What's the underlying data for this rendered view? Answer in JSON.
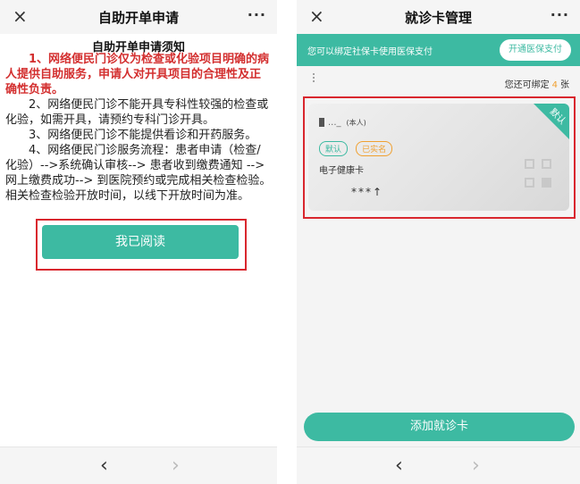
{
  "left": {
    "title": "自助开单申请",
    "close_icon": "×",
    "more_icon": "···",
    "heading": "自助开单申请须知",
    "paragraphs": [
      "1、网络便民门诊仅为检查或化验项目明确的病人提供自助服务，申请人对开具项目的合理性及正确性负责。",
      "2、网络便民门诊不能开具专科性较强的检查或化验，如需开具，请预约专科门诊开具。",
      "3、网络便民门诊不能提供看诊和开药服务。",
      "4、网络便民门诊服务流程：患者申请（检查/化验）-->系统确认审核--> 患者收到缴费通知 -->网上缴费成功--> 到医院预约或完成相关检查检验。相关检查检验开放时间，以线下开放时间为准。"
    ],
    "read_button": "我已阅读",
    "nav": {
      "back": "‹",
      "forward": "›"
    }
  },
  "right": {
    "title": "就诊卡管理",
    "close_icon": "×",
    "more_icon": "···",
    "banner_text": "您可以绑定社保卡使用医保支付",
    "banner_button": "开通医保支付",
    "bind_prefix": "您还可绑定",
    "bind_count": "4",
    "bind_suffix": "张",
    "card": {
      "name_mask": "..._",
      "self_label": "(本人)",
      "tag_default": "默认",
      "tag_verified": "已实名",
      "type": "电子健康卡",
      "number_mask": "***↑",
      "corner_label": "默认"
    },
    "add_button": "添加就诊卡",
    "nav": {
      "back": "‹",
      "forward": "›"
    }
  },
  "colors": {
    "accent": "#3dbaa2",
    "alert": "#d32f2f",
    "highlight_border": "#d9272e",
    "count": "#f0a030"
  }
}
